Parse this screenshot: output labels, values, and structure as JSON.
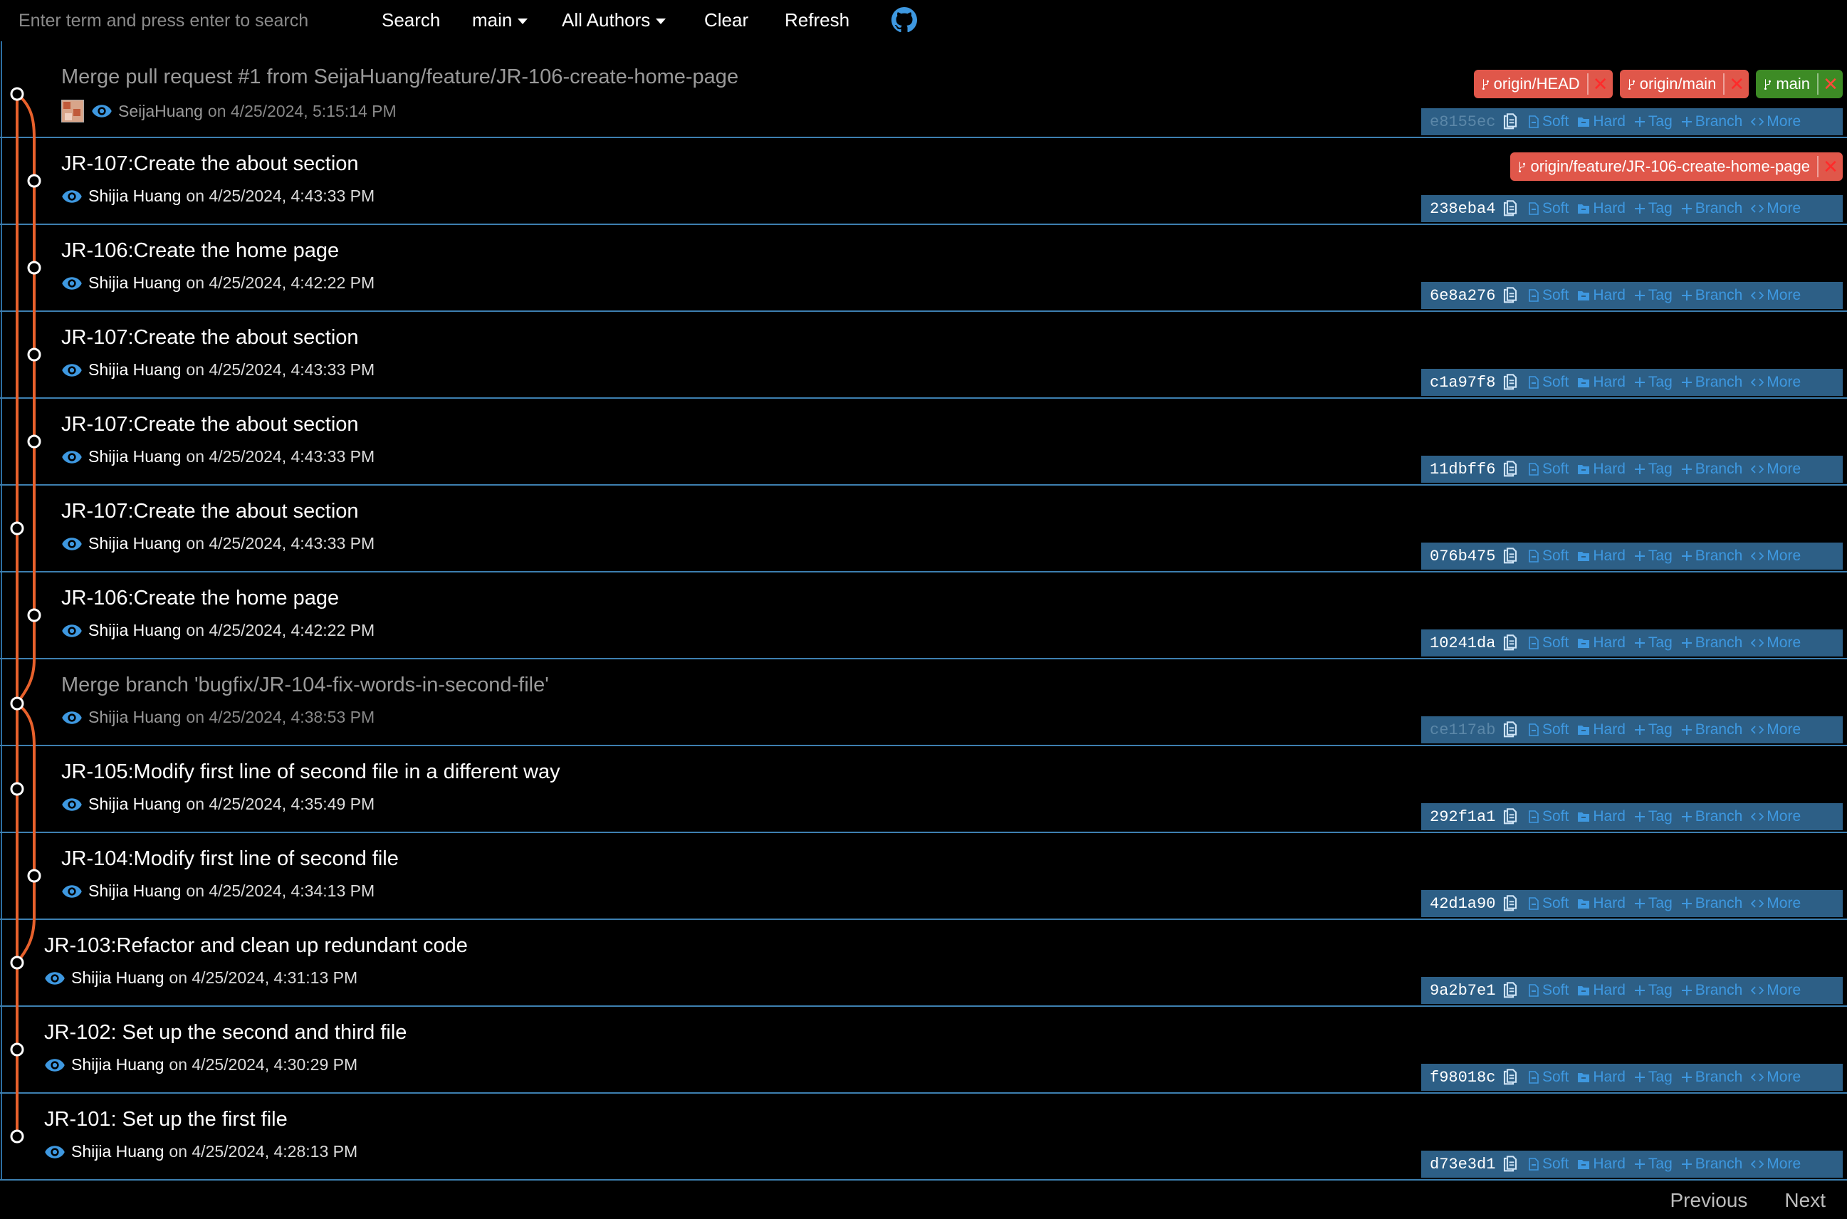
{
  "toolbar": {
    "search_placeholder": "Enter term and press enter to search",
    "search_label": "Search",
    "branch_label": "main",
    "authors_label": "All Authors",
    "clear_label": "Clear",
    "refresh_label": "Refresh"
  },
  "actions": {
    "soft": "Soft",
    "hard": "Hard",
    "tag": "Tag",
    "branch": "Branch",
    "more": "More"
  },
  "commits": [
    {
      "message": "Merge pull request #1 from SeijaHuang/feature/JR-106-create-home-page",
      "author": "SeijaHuang",
      "date": "on 4/25/2024, 5:15:14 PM",
      "hash": "e8155ec",
      "merge": true,
      "avatar": true,
      "refs": [
        {
          "name": "origin/HEAD",
          "color": "red"
        },
        {
          "name": "origin/main",
          "color": "red"
        },
        {
          "name": "main",
          "color": "green"
        }
      ]
    },
    {
      "message": "JR-107:Create the about section",
      "author": "Shijia Huang",
      "date": "on 4/25/2024, 4:43:33 PM",
      "hash": "238eba4",
      "refs": [
        {
          "name": "origin/feature/JR-106-create-home-page",
          "color": "red"
        }
      ]
    },
    {
      "message": "JR-106:Create the home page",
      "author": "Shijia Huang",
      "date": "on 4/25/2024, 4:42:22 PM",
      "hash": "6e8a276"
    },
    {
      "message": "JR-107:Create the about section",
      "author": "Shijia Huang",
      "date": "on 4/25/2024, 4:43:33 PM",
      "hash": "c1a97f8"
    },
    {
      "message": "JR-107:Create the about section",
      "author": "Shijia Huang",
      "date": "on 4/25/2024, 4:43:33 PM",
      "hash": "11dbff6"
    },
    {
      "message": "JR-107:Create the about section",
      "author": "Shijia Huang",
      "date": "on 4/25/2024, 4:43:33 PM",
      "hash": "076b475"
    },
    {
      "message": "JR-106:Create the home page",
      "author": "Shijia Huang",
      "date": "on 4/25/2024, 4:42:22 PM",
      "hash": "10241da"
    },
    {
      "message": "Merge branch 'bugfix/JR-104-fix-words-in-second-file'",
      "author": "Shijia Huang",
      "date": "on 4/25/2024, 4:38:53 PM",
      "hash": "ce117ab",
      "merge": true
    },
    {
      "message": "JR-105:Modify first line of second file in a different way",
      "author": "Shijia Huang",
      "date": "on 4/25/2024, 4:35:49 PM",
      "hash": "292f1a1"
    },
    {
      "message": "JR-104:Modify first line of second file",
      "author": "Shijia Huang",
      "date": "on 4/25/2024, 4:34:13 PM",
      "hash": "42d1a90"
    },
    {
      "message": "JR-103:Refactor and clean up redundant code",
      "author": "Shijia Huang",
      "date": "on 4/25/2024, 4:31:13 PM",
      "hash": "9a2b7e1"
    },
    {
      "message": "JR-102: Set up the second and third file",
      "author": "Shijia Huang",
      "date": "on 4/25/2024, 4:30:29 PM",
      "hash": "f98018c"
    },
    {
      "message": "JR-101: Set up the first file",
      "author": "Shijia Huang",
      "date": "on 4/25/2024, 4:28:13 PM",
      "hash": "d73e3d1"
    }
  ],
  "pager": {
    "previous": "Previous",
    "next": "Next"
  },
  "colors": {
    "graph_line": "#e8612c",
    "row_border": "#3d7fb0",
    "action_bar": "#2d5f86",
    "action_link": "#3e98e0",
    "ref_red": "#e0574a",
    "ref_green": "#3d8b25"
  }
}
